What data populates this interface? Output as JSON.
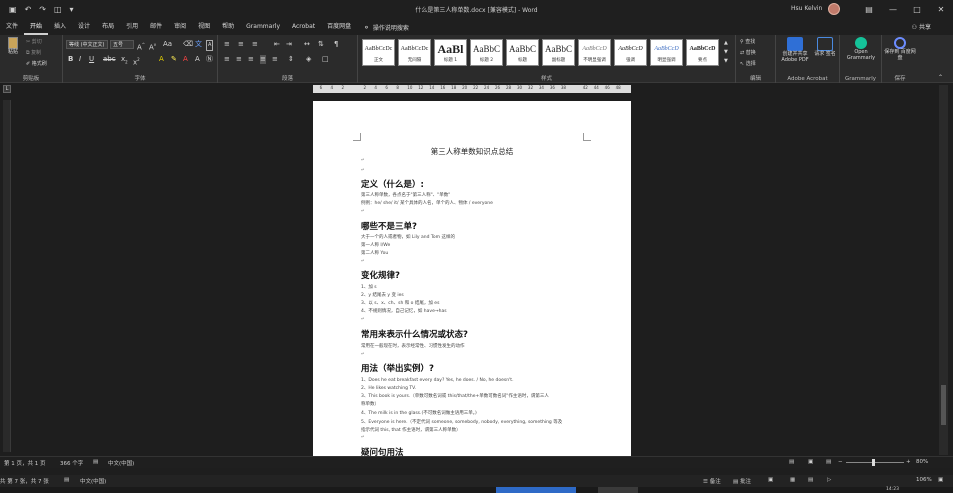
{
  "window": {
    "title": "什么是第三人称单数.docx [兼容模式] - Word",
    "user_name": "Hsu Kelvin",
    "share_label": "共享"
  },
  "qat": {
    "save_icon": "save-icon",
    "undo_icon": "undo-icon",
    "redo_icon": "redo-icon"
  },
  "tabs": [
    "文件",
    "开始",
    "插入",
    "设计",
    "布局",
    "引用",
    "邮件",
    "审阅",
    "视图",
    "帮助",
    "Grammarly",
    "Acrobat",
    "百度网盘"
  ],
  "active_tab": "开始",
  "tell_me": "操作说明搜索",
  "ribbon": {
    "clipboard": {
      "paste": "粘贴",
      "cut": "剪切",
      "copy": "复制",
      "format_painter": "格式刷",
      "label": "剪贴板"
    },
    "font": {
      "font_name": "等线 (中文正文)",
      "font_size": "五号",
      "label": "字体"
    },
    "paragraph": {
      "label": "段落"
    },
    "styles": {
      "label": "样式",
      "items": [
        {
          "sample": "AaBbCcDc",
          "name": "正文"
        },
        {
          "sample": "AaBbCcDc",
          "name": "无间隔"
        },
        {
          "sample": "AaBl",
          "name": "标题 1"
        },
        {
          "sample": "AaBbC",
          "name": "标题 2"
        },
        {
          "sample": "AaBbC",
          "name": "标题"
        },
        {
          "sample": "AaBbC",
          "name": "副标题"
        },
        {
          "sample": "AaBbCcD",
          "name": "不明显强调"
        },
        {
          "sample": "AaBbCcD",
          "name": "强调"
        },
        {
          "sample": "AaBbCcD",
          "name": "明显强调"
        },
        {
          "sample": "AaBbCcD",
          "name": "要点"
        }
      ]
    },
    "editing": {
      "find": "查找",
      "replace": "替换",
      "select": "选择",
      "label": "编辑"
    },
    "acrobat": {
      "create_pdf": "创建并共享 Adobe PDF",
      "request_sign": "请求 签名",
      "label": "Adobe Acrobat"
    },
    "grammarly": {
      "open": "Open Grammarly",
      "label": "Grammarly"
    },
    "baidu": {
      "save": "保存到 百度网盘",
      "label": "保存"
    }
  },
  "ruler": {
    "ticks": [
      "6",
      "4",
      "2",
      "",
      "2",
      "4",
      "6",
      "8",
      "10",
      "12",
      "14",
      "16",
      "18",
      "20",
      "22",
      "24",
      "26",
      "28",
      "30",
      "32",
      "34",
      "36",
      "38",
      "",
      "42",
      "44",
      "46",
      "48"
    ]
  },
  "document": {
    "title": "第三人称单数知识点总结",
    "sections": [
      {
        "heading": "定义（什么是）:",
        "lines": [
          "第三人称单数，各点名于\"第三人称\"、\"单数\"",
          "例例：he/ she/ it/ 某个具体的人名，单个的人、物体 / everyone"
        ]
      },
      {
        "heading": "哪些不是三单?",
        "lines": [
          "大于一个的人或者物，如 Lily and Tom 这样的",
          "第一人称 I/We",
          "第二人称 You"
        ]
      },
      {
        "heading": "变化规律?",
        "lines": [
          "1、加 s",
          "2、y 结尾去 y 变 ies",
          "3、以 s、x、ch、sh 和 o 结尾，加 es",
          "4、不规则情况，自己记忆，如 have→has"
        ]
      },
      {
        "heading": "常用来表示什么情况或状态?",
        "lines": [
          "常用在一般现在时，表示经常性、习惯性发生的动作"
        ]
      },
      {
        "heading": "用法（举出实例）?",
        "lines": [
          "1、Does he eat breakfast every day? Yes, he does. / No, he doesn't.",
          "2、He likes watching TV.",
          "3、This book is yours.（单数可数名词或 this/that/the+单数可数名词\"作主语时，谓第三人",
          "称单数）",
          "4、The milk is in the glass.(不可数名词做主语用三单。)",
          "5、Everyone is here.（不定代词 someone, somebody, nobody, everything, something 等及",
          "指示代词 this, that 作主语时，谓第三人称单数）"
        ]
      },
      {
        "heading": "疑问句用法",
        "lines": []
      }
    ]
  },
  "status": {
    "page": "第 1 页，共 1 页",
    "words": "366 个字",
    "language": "中文(中国)",
    "zoom": "80%"
  },
  "status2": {
    "page_info": "共 第 7 张，共 7 张",
    "language": "中文(中国)",
    "notes": "备注",
    "comments": "批注",
    "zoom": "106%",
    "clock": "14:23"
  }
}
